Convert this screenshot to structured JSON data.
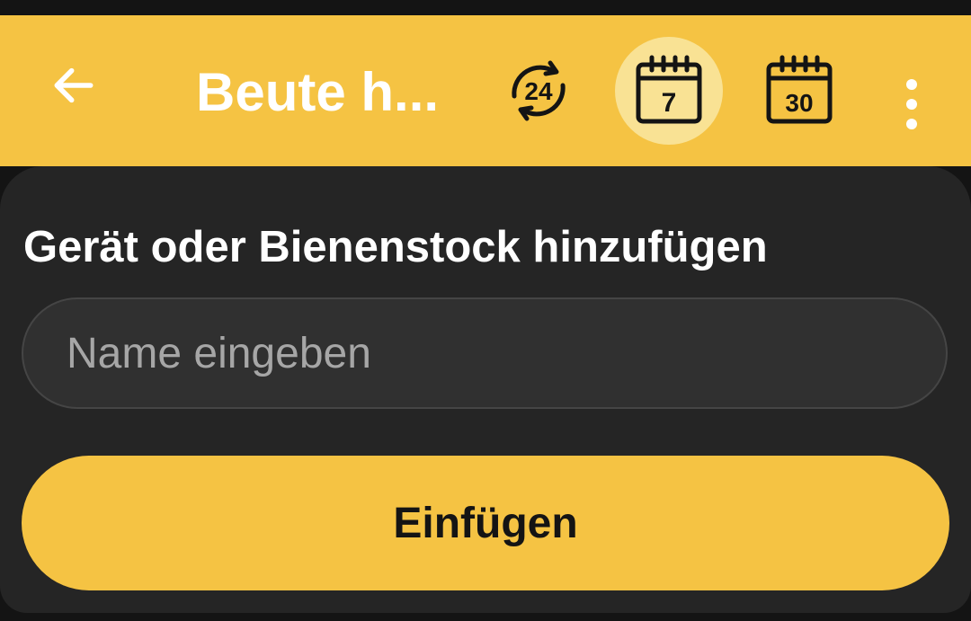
{
  "colors": {
    "accent": "#f5c343",
    "accent_selected_bg": "#f9e294",
    "sheet_bg": "#252525",
    "input_bg": "#303030",
    "page_bg": "#141414"
  },
  "app_bar": {
    "back_icon": "arrow-left-icon",
    "title": "Beute h...",
    "range_buttons": [
      {
        "icon": "rotate-24h-icon",
        "label": "24",
        "selected": false
      },
      {
        "icon": "calendar-7-icon",
        "label": "7",
        "selected": true
      },
      {
        "icon": "calendar-30-icon",
        "label": "30",
        "selected": false
      }
    ],
    "more_icon": "more-vertical-icon"
  },
  "dialog": {
    "title": "Gerät oder Bienenstock hinzufügen",
    "name_input": {
      "value": "",
      "placeholder": "Name eingeben"
    },
    "submit_label": "Einfügen"
  }
}
